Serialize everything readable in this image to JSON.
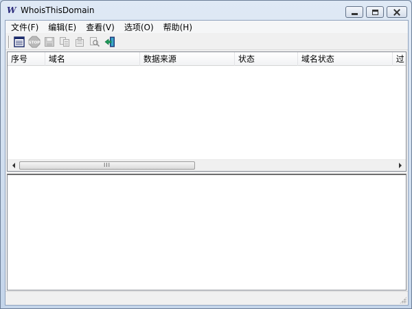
{
  "window": {
    "title": "WhoisThisDomain",
    "app_icon_text": "W"
  },
  "menu": {
    "items": [
      {
        "label": "文件(F)"
      },
      {
        "label": "编辑(E)"
      },
      {
        "label": "查看(V)"
      },
      {
        "label": "选项(O)"
      },
      {
        "label": "帮助(H)"
      }
    ]
  },
  "toolbar": {
    "buttons": [
      {
        "icon": "list-icon",
        "enabled": true
      },
      {
        "icon": "stop-icon",
        "enabled": false
      },
      {
        "icon": "save-icon",
        "enabled": false
      },
      {
        "icon": "copy-icon",
        "enabled": false
      },
      {
        "icon": "properties-icon",
        "enabled": false
      },
      {
        "icon": "find-icon",
        "enabled": false
      },
      {
        "icon": "exit-icon",
        "enabled": true
      }
    ],
    "stop_text": "STOP"
  },
  "list": {
    "columns": [
      {
        "label": "序号"
      },
      {
        "label": "域名"
      },
      {
        "label": "数据来源"
      },
      {
        "label": "状态"
      },
      {
        "label": "域名状态"
      },
      {
        "label": "过"
      }
    ],
    "rows": [],
    "scroll_thumb_grip": "III"
  },
  "colors": {
    "accent": "#2a2a7a",
    "exit_green": "#1f9a5a"
  }
}
